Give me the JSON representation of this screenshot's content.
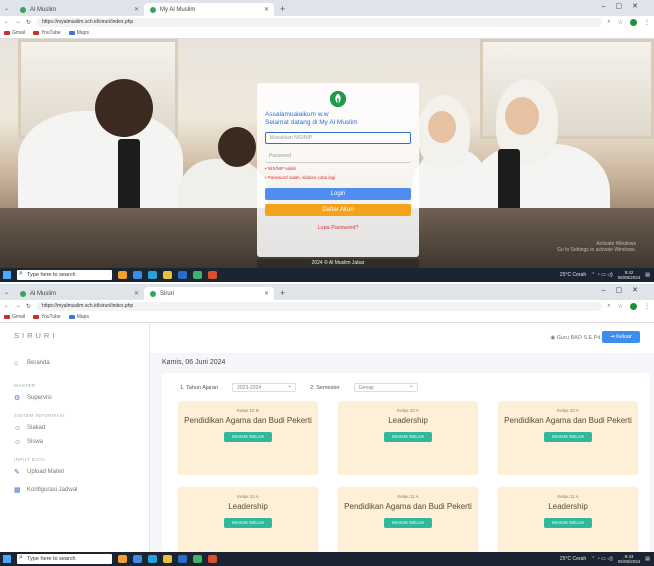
{
  "shot1": {
    "tabs": [
      {
        "label": "Al Muslim"
      },
      {
        "label": "My Al Muslim"
      }
    ],
    "url": "https://myalmuslim.sch.id/siruri/index.php",
    "bookmarks": [
      "Gmail",
      "YouTube",
      "Maps"
    ],
    "login": {
      "welcome_line1": "Assalamualaikum w.w",
      "welcome_line2": "Selamat datang di My Al Muslim",
      "username_placeholder": "Masukkan NIS/NIP",
      "password_placeholder": "Password",
      "error_lines": [
        "• NIS/NIP salah",
        "• Password salah, silakan coba lagi"
      ],
      "login_label": "Login",
      "daftar_label": "Daftar Akun",
      "lupa_label": "Lupa Password?",
      "copyright": "2024 © Al Muslim Jabar",
      "watermark_line1": "Activate Windows",
      "watermark_line2": "Go to Settings to activate Windows."
    },
    "taskbar": {
      "search": "Type here to search",
      "weather": "25°C Cerah",
      "time": "9:42",
      "date": "06/06/2024"
    }
  },
  "shot2": {
    "tabs": [
      {
        "label": "Al Muslim"
      },
      {
        "label": "Siruri"
      }
    ],
    "url": "https://myalmuslim.sch.id/siruri/index.php",
    "bookmarks": [
      "Gmail",
      "YouTube",
      "Maps"
    ],
    "brand": "SIRURI",
    "sidebar": {
      "items": [
        {
          "icon": "home-icon",
          "label": "Beranda"
        },
        {
          "head": "MASTER"
        },
        {
          "icon": "user-check-icon",
          "label": "Supervisi"
        },
        {
          "head": "SISTEM INFORMASI"
        },
        {
          "icon": "user-icon",
          "label": "Siakad"
        },
        {
          "icon": "users-icon",
          "label": "Siswa"
        },
        {
          "head": "INPUT DATA"
        },
        {
          "icon": "upload-icon",
          "label": "Upload Materi"
        },
        {
          "icon": "calendar-icon",
          "label": "Konfigurasi Jadwal"
        }
      ]
    },
    "user": "Guru BAD S.E.Pd.",
    "keluar_label": "Keluar",
    "date": "Kamis, 06 Juni 2024",
    "filters": {
      "tahun_label": "Tahun Ajaran",
      "tahun_value": "2023-2024",
      "semester_label": "Semester",
      "semester_value": "Genap"
    },
    "classes": [
      {
        "kelas": "Kelas 10 D",
        "mapel": "Pendidikan Agama dan Budi Pekerti",
        "btn": "MASUK KELAS"
      },
      {
        "kelas": "Kelas 10 A",
        "mapel": "Leadership",
        "btn": "MASUK KELAS"
      },
      {
        "kelas": "Kelas 10 A",
        "mapel": "Pendidikan Agama dan Budi Pekerti",
        "btn": "MASUK KELAS"
      },
      {
        "kelas": "Kelas 10 A",
        "mapel": "Leadership",
        "btn": "MASUK KELAS"
      },
      {
        "kelas": "Kelas 11 A",
        "mapel": "Pendidikan Agama dan Budi Pekerti",
        "btn": "MASUK KELAS"
      },
      {
        "kelas": "Kelas 11 A",
        "mapel": "Leadership",
        "btn": "MASUK KELAS"
      }
    ],
    "taskbar": {
      "search": "Type here to search",
      "weather": "25°C Cerah",
      "time": "9:43",
      "date": "06/06/2024"
    }
  }
}
